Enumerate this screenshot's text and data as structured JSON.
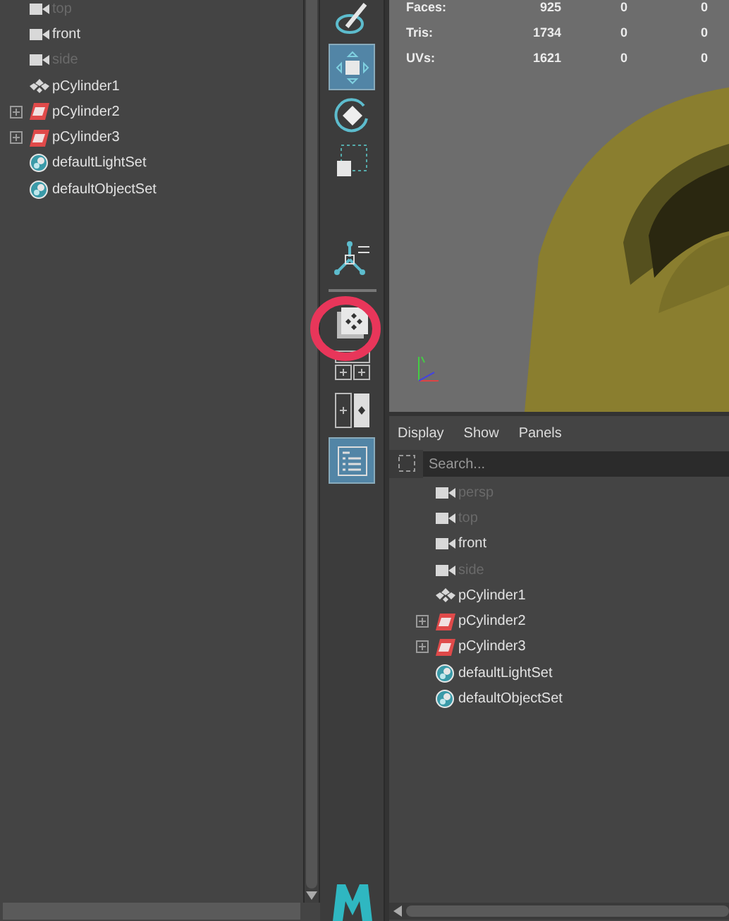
{
  "left_outliner": {
    "items": [
      {
        "label": "top",
        "kind": "camera",
        "dimmed": true,
        "expandable": false
      },
      {
        "label": "front",
        "kind": "camera",
        "dimmed": false,
        "expandable": false
      },
      {
        "label": "side",
        "kind": "camera",
        "dimmed": true,
        "expandable": false
      },
      {
        "label": "pCylinder1",
        "kind": "group",
        "dimmed": false,
        "expandable": false
      },
      {
        "label": "pCylinder2",
        "kind": "mesh",
        "dimmed": false,
        "expandable": true
      },
      {
        "label": "pCylinder3",
        "kind": "mesh",
        "dimmed": false,
        "expandable": true
      },
      {
        "label": "defaultLightSet",
        "kind": "set",
        "dimmed": false,
        "expandable": false
      },
      {
        "label": "defaultObjectSet",
        "kind": "set",
        "dimmed": false,
        "expandable": false
      }
    ]
  },
  "toolbox": {
    "tools": [
      {
        "kind": "paint",
        "selected": false
      },
      {
        "kind": "move",
        "selected": true
      },
      {
        "kind": "rotate",
        "selected": false
      },
      {
        "kind": "scale",
        "selected": false
      },
      {
        "kind": "manipulator",
        "selected": false
      },
      {
        "kind": "layers",
        "selected": false
      },
      {
        "kind": "layout-quad",
        "selected": false
      },
      {
        "kind": "layout-split",
        "selected": false
      },
      {
        "kind": "outliner",
        "selected": true
      }
    ]
  },
  "viewport": {
    "stats": [
      {
        "label": "Faces:",
        "values": [
          "925",
          "0",
          "0"
        ]
      },
      {
        "label": "Tris:",
        "values": [
          "1734",
          "0",
          "0"
        ]
      },
      {
        "label": "UVs:",
        "values": [
          "1621",
          "0",
          "0"
        ]
      }
    ]
  },
  "outliner": {
    "menu": [
      "Display",
      "Show",
      "Panels"
    ],
    "search": {
      "placeholder": "Search..."
    },
    "items": [
      {
        "label": "persp",
        "kind": "camera",
        "dimmed": true,
        "expandable": false
      },
      {
        "label": "top",
        "kind": "camera",
        "dimmed": true,
        "expandable": false
      },
      {
        "label": "front",
        "kind": "camera",
        "dimmed": false,
        "expandable": false
      },
      {
        "label": "side",
        "kind": "camera",
        "dimmed": true,
        "expandable": false
      },
      {
        "label": "pCylinder1",
        "kind": "group",
        "dimmed": false,
        "expandable": false
      },
      {
        "label": "pCylinder2",
        "kind": "mesh",
        "dimmed": false,
        "expandable": true
      },
      {
        "label": "pCylinder3",
        "kind": "mesh",
        "dimmed": false,
        "expandable": true
      },
      {
        "label": "defaultLightSet",
        "kind": "set",
        "dimmed": false,
        "expandable": false
      },
      {
        "label": "defaultObjectSet",
        "kind": "set",
        "dimmed": false,
        "expandable": false
      }
    ]
  }
}
